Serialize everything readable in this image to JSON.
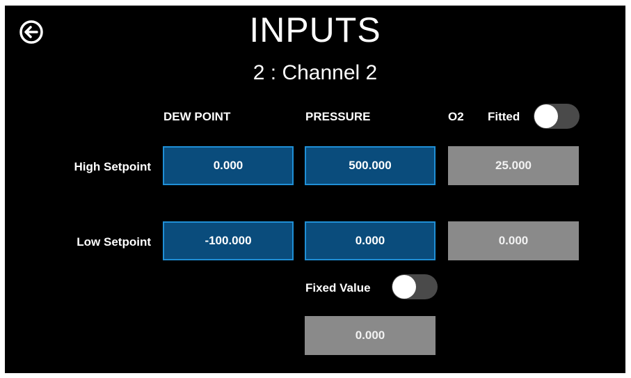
{
  "header": {
    "title": "INPUTS",
    "subtitle": "2 : Channel 2"
  },
  "columns": {
    "dew_point": "DEW POINT",
    "pressure": "PRESSURE",
    "o2": "O2"
  },
  "o2_fitted": {
    "label": "Fitted",
    "on": false
  },
  "rows": {
    "high_label": "High Setpoint",
    "low_label": "Low Setpoint"
  },
  "values": {
    "dew_high": "0.000",
    "dew_low": "-100.000",
    "pressure_high": "500.000",
    "pressure_low": "0.000",
    "o2_high": "25.000",
    "o2_low": "0.000"
  },
  "fixed_value": {
    "label": "Fixed Value",
    "on": false,
    "value": "0.000"
  },
  "colors": {
    "active_field": "#0a4c7c",
    "active_border": "#1f8fd6",
    "disabled_field": "#8a8a8a",
    "toggle_track": "#4a4a4a"
  },
  "icons": {
    "back": "back-arrow-icon"
  }
}
